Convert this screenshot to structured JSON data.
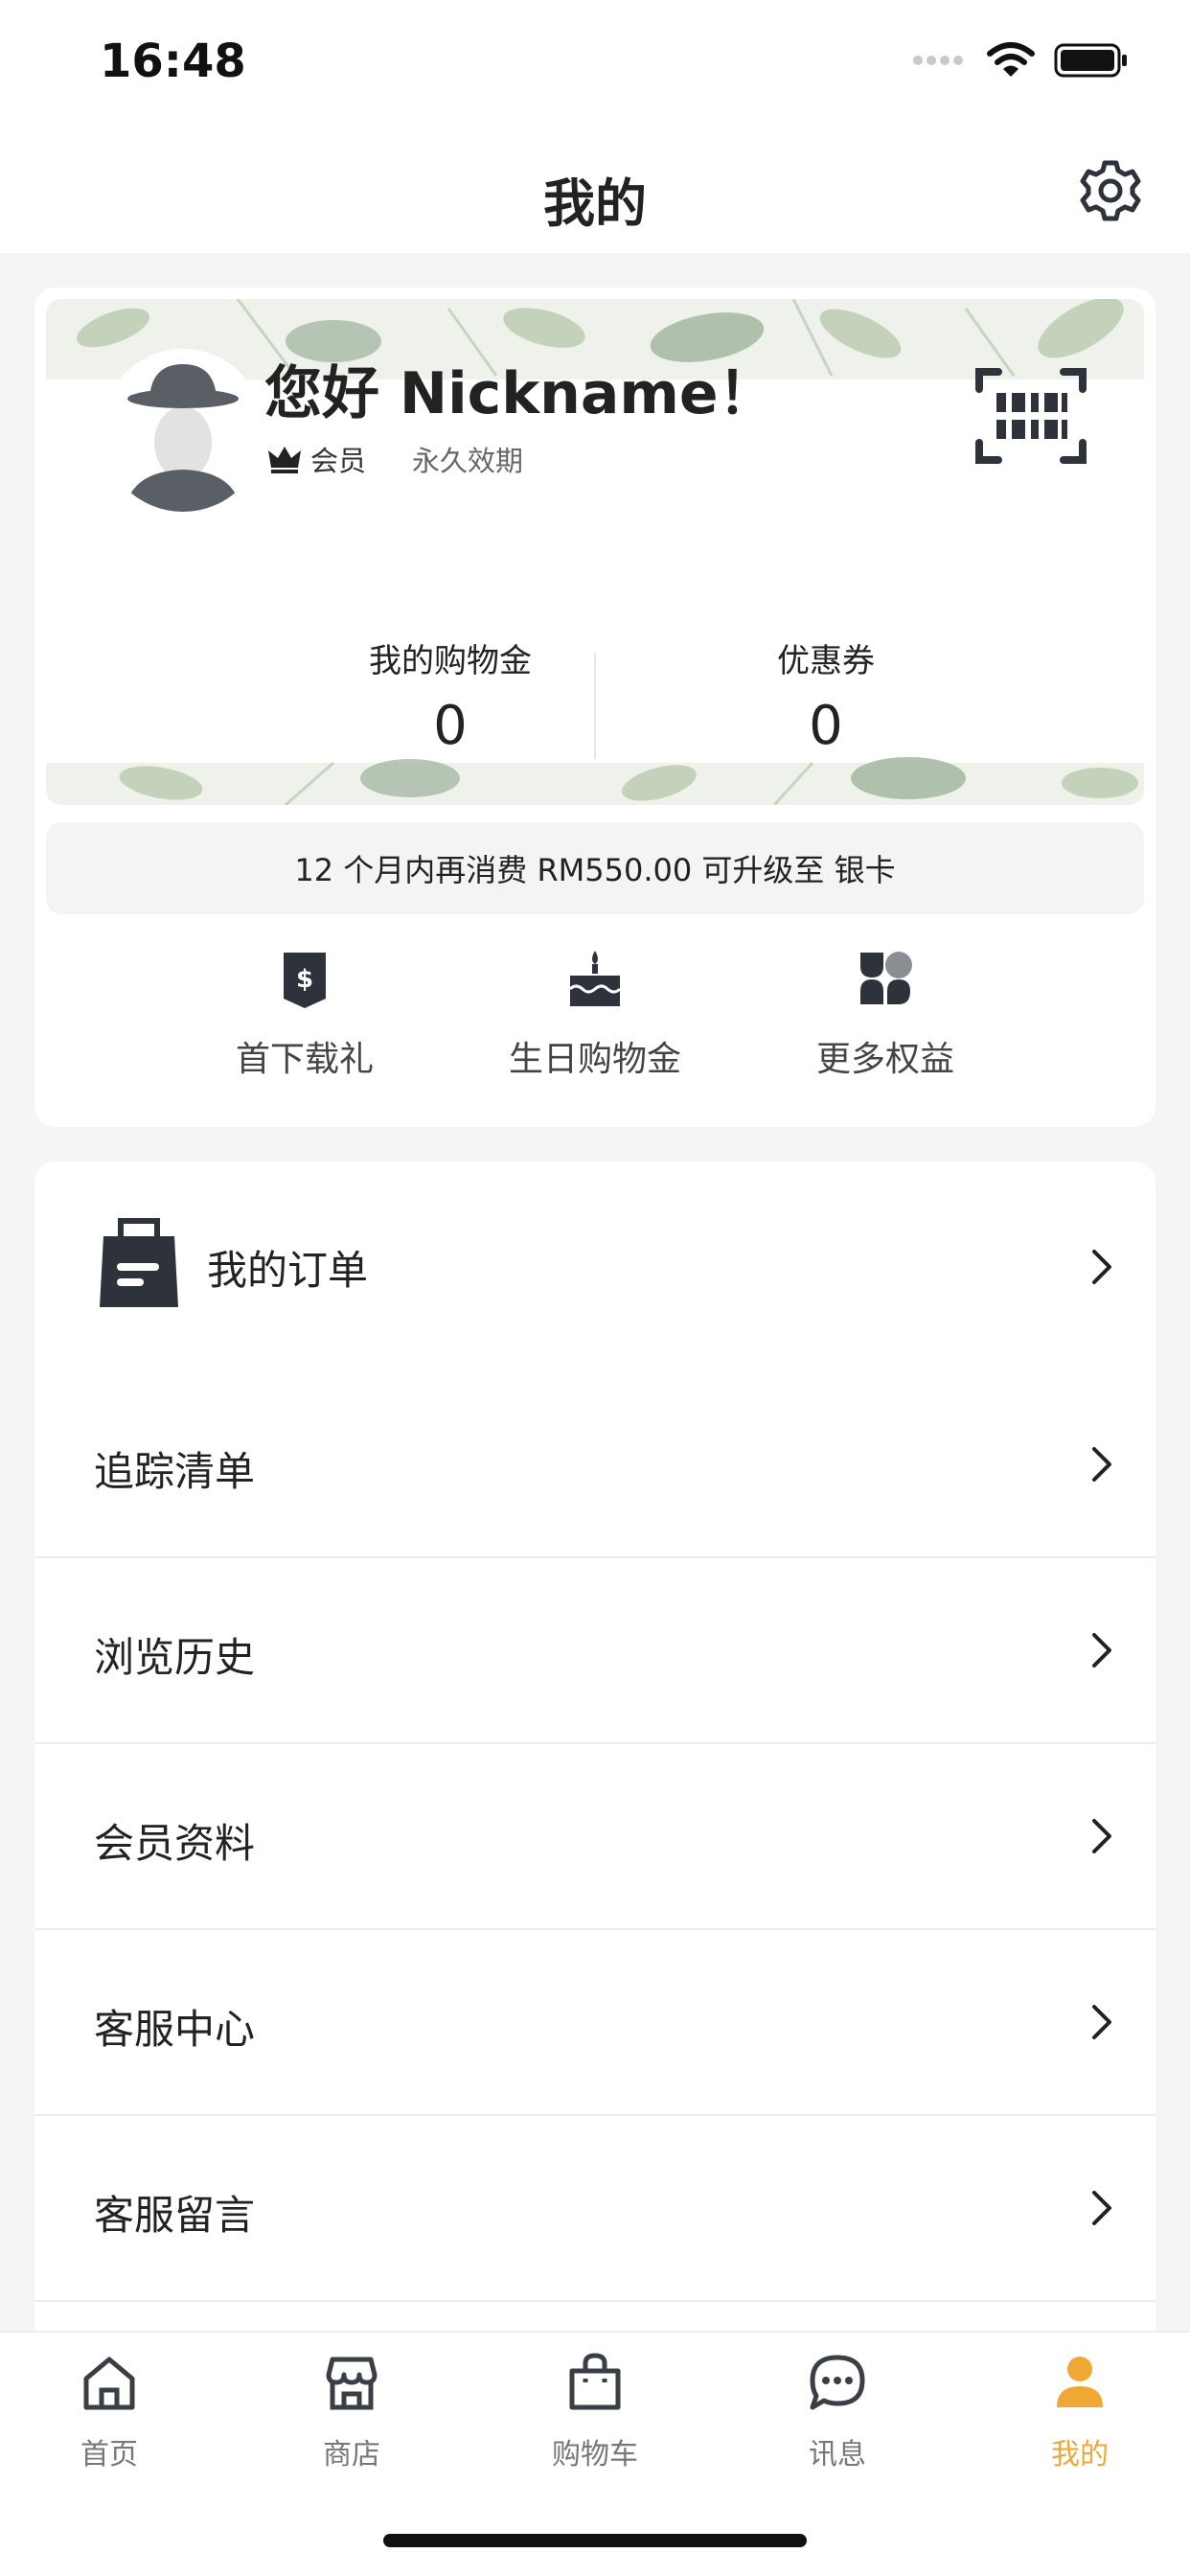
{
  "status_bar": {
    "time": "16:48"
  },
  "nav": {
    "title": "我的"
  },
  "profile": {
    "greeting": "您好 Nickname！",
    "tier": "会员",
    "validity": "永久效期"
  },
  "stats": [
    {
      "label": "我的购物金",
      "value": "0"
    },
    {
      "label": "优惠券",
      "value": "0"
    }
  ],
  "upgrade_text": "12 个月内再消费 RM550.00 可升级至 银卡",
  "benefits": [
    {
      "label": "首下载礼",
      "icon": "dollar-tag-icon"
    },
    {
      "label": "生日购物金",
      "icon": "birthday-cake-icon"
    },
    {
      "label": "更多权益",
      "icon": "clover-grid-icon"
    }
  ],
  "menu": {
    "orders": {
      "label": "我的订单",
      "icon": "shopping-bag-icon"
    },
    "items": [
      {
        "label": "追踪清单"
      },
      {
        "label": "浏览历史"
      },
      {
        "label": "会员资料"
      },
      {
        "label": "客服中心"
      },
      {
        "label": "客服留言"
      }
    ]
  },
  "tabs": [
    {
      "label": "首页",
      "icon": "home-icon",
      "active": false
    },
    {
      "label": "商店",
      "icon": "store-icon",
      "active": false
    },
    {
      "label": "购物车",
      "icon": "cart-bag-icon",
      "active": false
    },
    {
      "label": "讯息",
      "icon": "chat-icon",
      "active": false
    },
    {
      "label": "我的",
      "icon": "person-icon",
      "active": true
    }
  ],
  "colors": {
    "accent": "#f0a835",
    "icon_dark": "#2e333b",
    "background": "#f5f5f5"
  }
}
